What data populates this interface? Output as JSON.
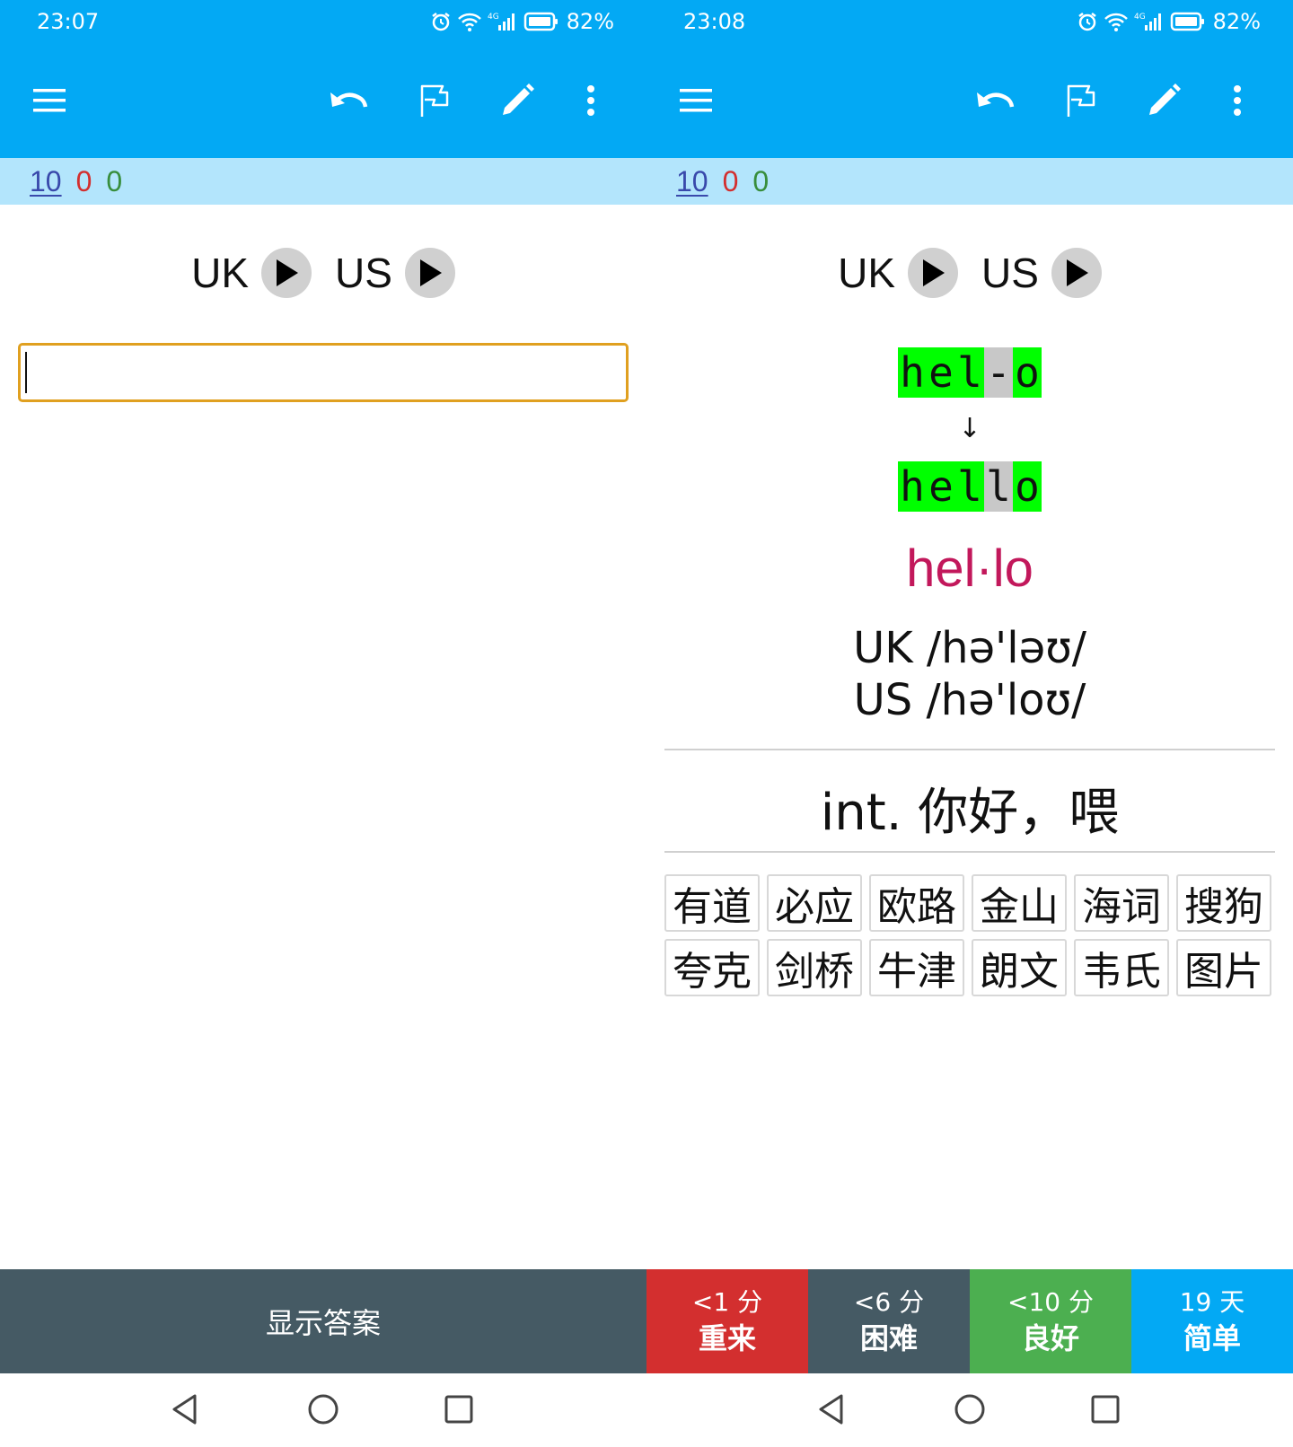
{
  "colors": {
    "appbar": "#03a9f4",
    "countbar": "#b3e5fc",
    "new_count": "#3949ab",
    "learning_count": "#d32f2f",
    "review_count": "#388e3c",
    "correct_highlight": "#00ff00",
    "wrong_highlight": "#c8c8c8",
    "syllable": "#c2185b",
    "show_answer_bg": "#455a64",
    "again": "#d32f2f",
    "hard": "#455a64",
    "good": "#4caf50",
    "easy": "#03a9f4"
  },
  "left": {
    "status": {
      "time": "23:07",
      "battery": "82%"
    },
    "toolbar_icons": [
      "menu-icon",
      "undo-icon",
      "flag-icon",
      "edit-icon",
      "more-vert-icon"
    ],
    "counts": {
      "new": "10",
      "learning": "0",
      "review": "0"
    },
    "audio": {
      "uk_label": "UK",
      "us_label": "US"
    },
    "input_value": "",
    "show_answer": "显示答案"
  },
  "right": {
    "status": {
      "time": "23:08",
      "battery": "82%"
    },
    "counts": {
      "new": "10",
      "learning": "0",
      "review": "0"
    },
    "audio": {
      "uk_label": "UK",
      "us_label": "US"
    },
    "typed_comparison": {
      "typed": [
        "h",
        "e",
        "l",
        "-",
        "o"
      ],
      "arrow": "↓",
      "correct": [
        "h",
        "e",
        "l",
        "l",
        "o"
      ],
      "status": [
        "ok",
        "ok",
        "ok",
        "bad",
        "ok"
      ]
    },
    "syllables": "hel·lo",
    "phonetic_uk": "UK /hə'ləʊ/",
    "phonetic_us": "US /hə'loʊ/",
    "meaning": "int. 你好，喂",
    "dictionaries": [
      "有道",
      "必应",
      "欧路",
      "金山",
      "海词",
      "搜狗",
      "夸克",
      "剑桥",
      "牛津",
      "朗文",
      "韦氏",
      "图片"
    ],
    "ease_buttons": [
      {
        "time": "<1 分",
        "label": "重来"
      },
      {
        "time": "<6 分",
        "label": "困难"
      },
      {
        "time": "<10 分",
        "label": "良好"
      },
      {
        "time": "19 天",
        "label": "简单"
      }
    ]
  }
}
